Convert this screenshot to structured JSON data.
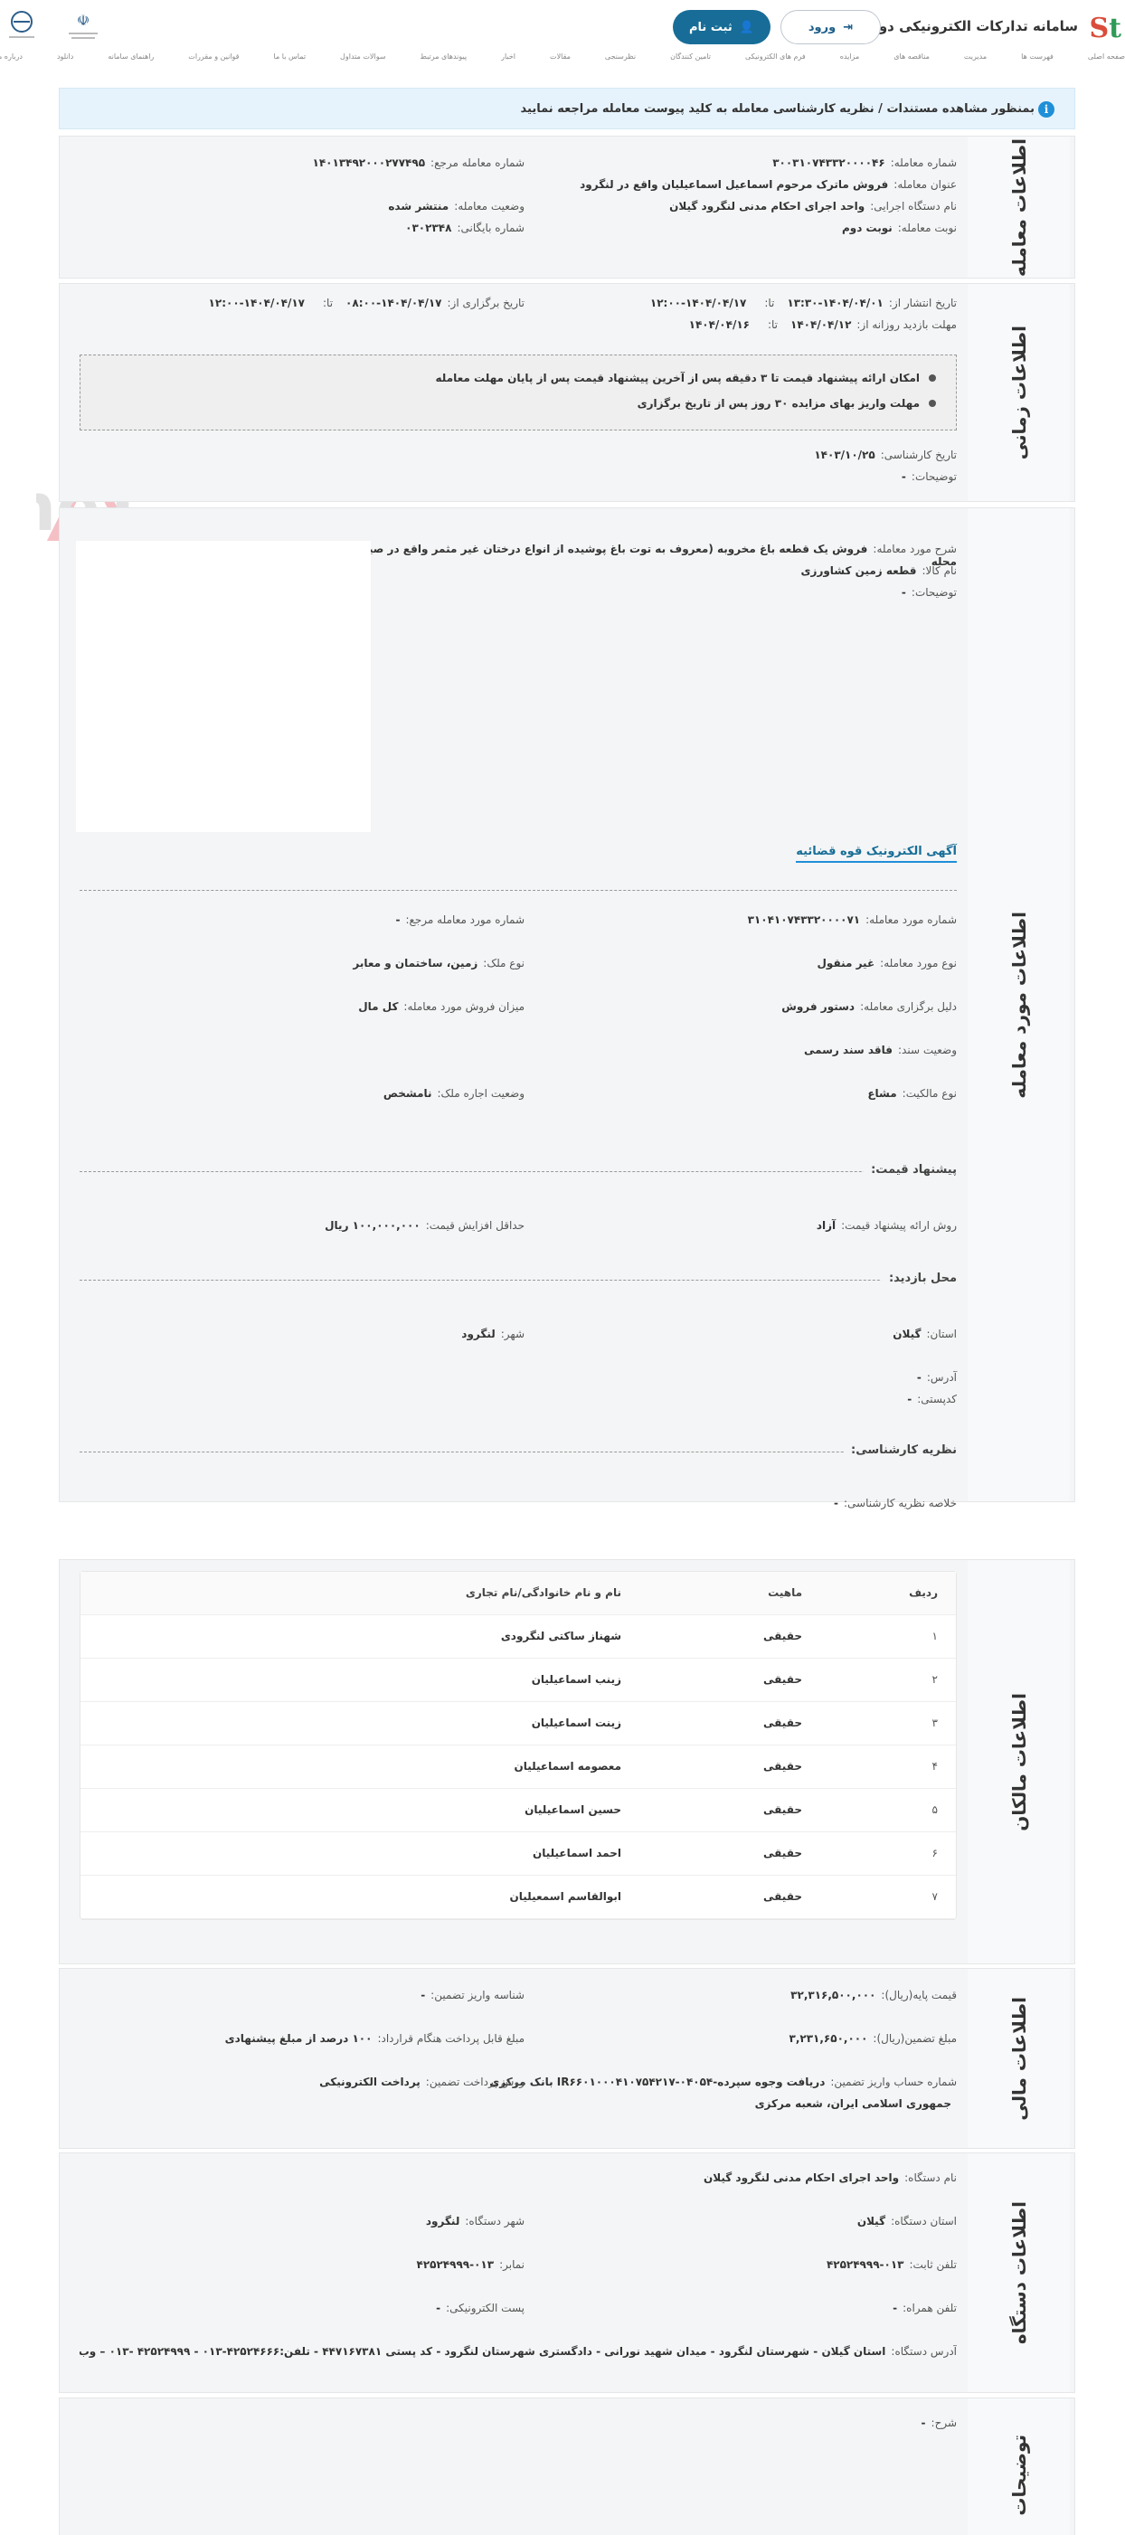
{
  "header": {
    "brand": "سامانه تدارکات الکترونیکی دولت",
    "login_label": "ورود",
    "register_label": "ثبت نام",
    "gov_logo_left_lines": [
      "معاونت نظارت",
      "ریاست جمهوری"
    ],
    "gov_logo_left2_line": "مرکز ملی حقوق و حقوق"
  },
  "nav": [
    "صفحه اصلی",
    "فهرست ها",
    "مدیریت",
    "مناقصه های",
    "مزایده",
    "فرم های الکترونیکی",
    "تامین کنندگان",
    "نظرسنجی",
    "مقالات",
    "اخبار",
    "پیوندهای مرتبط",
    "سوالات متداول",
    "تماس با ما",
    "قوانین و مقررات",
    "راهنمای سامانه",
    "دانلود",
    "درباره ما"
  ],
  "alert": "بمنظور مشاهده مستندات / نظریه کارشناسی معامله به کلید پیوست معامله مراجعه نمایید",
  "deal": {
    "title": "اطلاعات معامله",
    "number_label": "شماره معامله:",
    "number": "۳۰۰۳۱۰۷۴۳۳۲۰۰۰۰۴۶",
    "ref_label": "شماره معامله مرجع:",
    "ref": "۱۴۰۱۳۴۹۲۰۰۰۲۷۷۴۹۵",
    "subject_label": "عنوان معامله:",
    "subject": "فروش ماترک مرحوم اسماعیل اسماعیلیان واقع در لنگرود",
    "status_label": "وضعیت معامله:",
    "status": "منتشر شده",
    "device_label": "نام دستگاه اجرایی:",
    "device": "واحد اجرای احکام مدنی لنگرود گیلان",
    "archive_label": "شماره بایگانی:",
    "archive": "۰۳۰۲۳۴۸",
    "turn_label": "نوبت معامله:",
    "turn": "نوبت دوم"
  },
  "time": {
    "title": "اطلاعات زمانی",
    "publish_label": "تاریخ انتشار از:",
    "publish_from": "۱۴۰۴/۰۴/۰۱-۱۳:۳۰",
    "to_label": "تا:",
    "publish_to": "۱۴۰۴/۰۴/۱۷-۱۲:۰۰",
    "hold_label": "تاریخ برگزاری از:",
    "hold_from": "۱۴۰۴/۰۴/۱۷-۰۸:۰۰",
    "hold_to": "۱۴۰۴/۰۴/۱۷-۱۲:۰۰",
    "visit_label": "مهلت بازدید روزانه از:",
    "visit_from": "۱۴۰۴/۰۴/۱۲",
    "visit_to": "۱۴۰۴/۰۴/۱۶",
    "note1": "امکان ارائه پیشنهاد قیمت تا ۳ دقیقه پس از آخرین پیشنهاد قیمت پس از پایان مهلت معامله",
    "note2": "مهلت واریز بهای مزایده ۳۰ روز پس از تاریخ برگزاری",
    "expert_date_label": "تاریخ کارشناسی:",
    "expert_date": "۱۴۰۳/۱۰/۲۵",
    "desc_label": "توضیحات:",
    "desc": "-"
  },
  "item": {
    "title": "اطلاعات مورد معامله",
    "desc_label": "شرح مورد معامله:",
    "desc": "فروش یک قطعه باغ مخروبه (معروف به توت باغ پوشیده از انواع درختان غیر مثمر واقع در صیدر محله",
    "name_label": "نام کالا:",
    "name": "قطعه زمین کشاورزی",
    "notes_label": "توضیحات:",
    "notes": "-",
    "ad_link": "آگهی الکترونیک قوه قضائیه",
    "item_no_label": "شماره مورد معامله:",
    "item_no": "۳۱۰۴۱۰۷۴۳۳۲۰۰۰۰۷۱",
    "ref_item_label": "شماره مورد معامله مرجع:",
    "ref_item": "-",
    "type_label": "نوع مورد معامله:",
    "type": "غیر منقول",
    "prop_type_label": "نوع ملک:",
    "prop_type": "زمین، ساختمان و معابر",
    "reason_label": "دلیل برگزاری معامله:",
    "reason": "دستور فروش",
    "share_label": "میزان فروش مورد معامله:",
    "share": "کل مال",
    "deed_label": "وضعیت سند:",
    "deed": "فاقد سند رسمی",
    "owner_type_label": "نوع مالکیت:",
    "owner_type": "مشاع",
    "lease_label": "وضعیت اجاره ملک:",
    "lease": "نامشخص",
    "price_heading": "پیشنهاد قیمت:",
    "method_label": "روش ارائه پیشنهاد قیمت:",
    "method": "آزاد",
    "min_inc_label": "حداقل افزایش قیمت:",
    "min_inc": "۱۰۰,۰۰۰,۰۰۰ ریال",
    "visit_heading": "محل بازدید:",
    "province_label": "استان:",
    "province": "گیلان",
    "city_label": "شهر:",
    "city": "لنگرود",
    "address_label": "آدرس:",
    "address": "-",
    "postal_label": "کدپستی:",
    "postal": "-",
    "expert_heading": "نظریه کارشناسی:",
    "expert_sum_label": "خلاصه نظریه کارشناسی:",
    "expert_sum": "-"
  },
  "owners": {
    "title": "اطلاعات مالکان",
    "headers": [
      "ردیف",
      "ماهیت",
      "نام و نام خانوادگی/نام تجاری"
    ],
    "rows": [
      {
        "n": "۱",
        "kind": "حقیقی",
        "name": "شهناز ساکتی لنگرودی"
      },
      {
        "n": "۲",
        "kind": "حقیقی",
        "name": "زینب اسماعیلیان"
      },
      {
        "n": "۳",
        "kind": "حقیقی",
        "name": "زینت اسماعیلیان"
      },
      {
        "n": "۴",
        "kind": "حقیقی",
        "name": "معصومه اسماعیلیان"
      },
      {
        "n": "۵",
        "kind": "حقیقی",
        "name": "حسین اسماعیلیان"
      },
      {
        "n": "۶",
        "kind": "حقیقی",
        "name": "احمد اسماعیلیان"
      },
      {
        "n": "۷",
        "kind": "حقیقی",
        "name": "ابوالقاسم اسمعیلیان"
      }
    ]
  },
  "finance": {
    "title": "اطلاعات مالی",
    "base_label": "قیمت پایه(ریال):",
    "base": "۳۲,۳۱۶,۵۰۰,۰۰۰",
    "dep_id_label": "شناسه واریز تضمین:",
    "dep_id": "-",
    "guarantee_label": "مبلغ تضمین(ریال):",
    "guarantee": "۳,۲۳۱,۶۵۰,۰۰۰",
    "payable_label": "مبلغ قابل پرداخت هنگام قرارداد:",
    "payable": "۱۰۰ درصد از مبلغ پیشنهادی",
    "account_label": "شماره حساب واریز تضمین:",
    "account": "دریافت وجوه سپرده-IR۶۶۰۱۰۰۰۴۱۰۷۵۴۲۱۷-۰۴۰۵۴ بانک مرکزی",
    "account2": "جمهوری اسلامی ایران، شعبه مرکزی",
    "method_label": "روش پرداخت تضمین:",
    "method": "پرداخت الکترونیکی"
  },
  "device": {
    "title": "اطلاعات دستگاه",
    "name_label": "نام دستگاه:",
    "name": "واحد اجرای احکام مدنی لنگرود گیلان",
    "prov_label": "استان دستگاه:",
    "prov": "گیلان",
    "city_label": "شهر دستگاه:",
    "city": "لنگرود",
    "tel_label": "تلفن ثابت:",
    "tel": "۰۱۳-۴۲۵۲۴۹۹۹",
    "fax_label": "نمابر:",
    "fax": "۰۱۳-۴۲۵۲۴۹۹۹",
    "mobile_label": "تلفن همراه:",
    "mobile": "-",
    "email_label": "پست الکترونیکی:",
    "email": "-",
    "addr_label": "آدرس دستگاه:",
    "addr": "استان گیلان - شهرستان لنگرود - میدان شهید نورانی - دادگستری شهرستان لنگرود - کد پستی ۴۴۷۱۶۷۳۸۱ - تلفن:۴۲۵۲۴۶۶۶-۰۱۳ - ۴۲۵۲۴۹۹۹ -۰۱۳ – وب سایت www.dadgi"
  },
  "notes": {
    "title": "توضیحات",
    "desc_label": "شرح:",
    "desc": "-"
  },
  "watermark": "AriaTender.neT",
  "colors": {
    "primary": "#176d97",
    "alert_bg": "#e7f3fc",
    "section_bg": "#f4f5f6",
    "logo_red": "#d94d3a",
    "logo_green": "#2f9a57"
  }
}
